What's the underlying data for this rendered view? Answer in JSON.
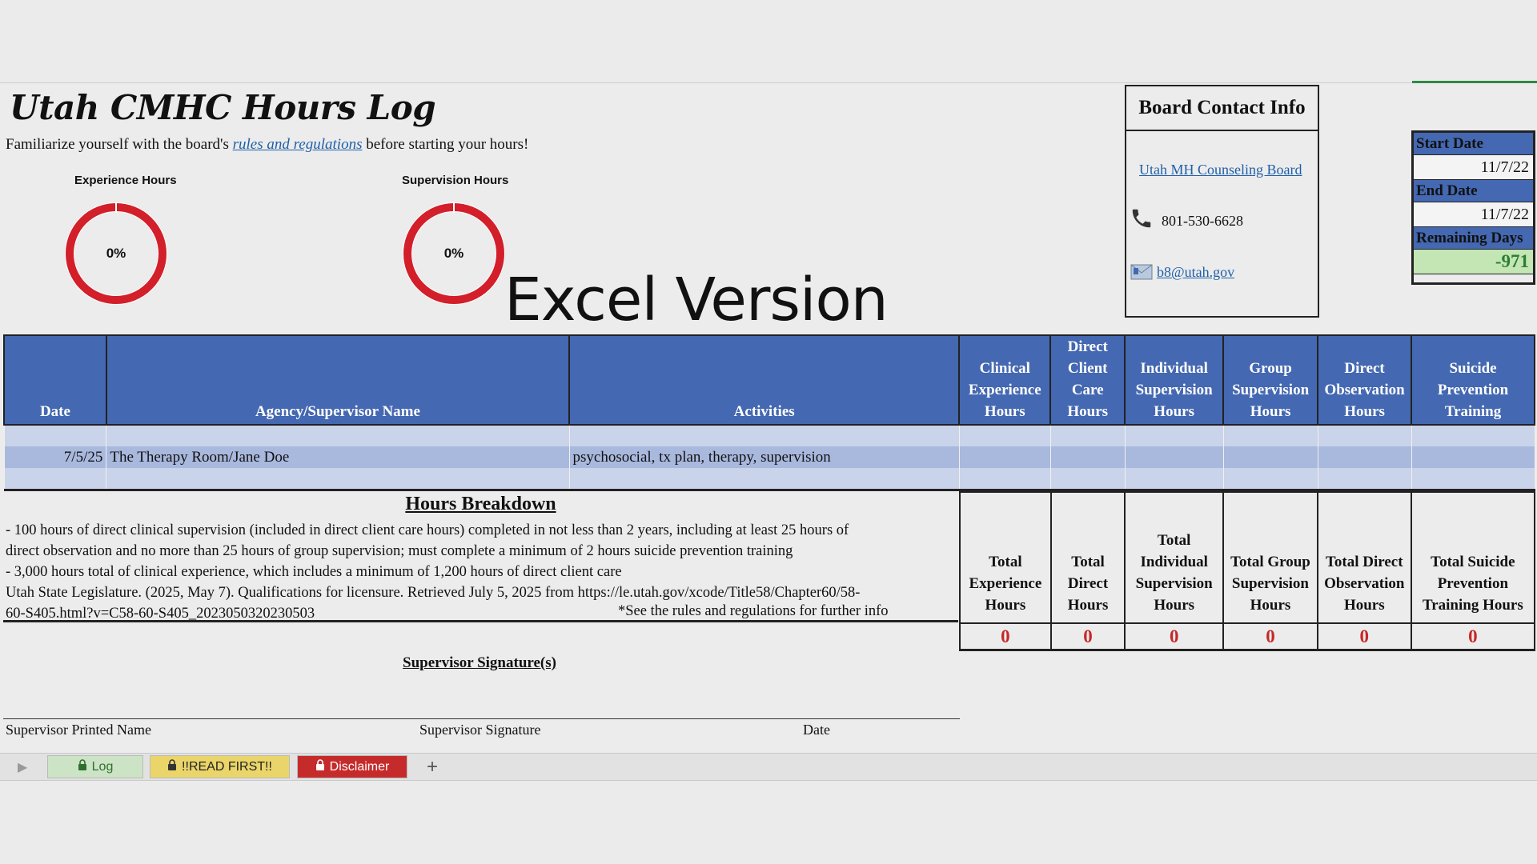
{
  "title": "Utah CMHC Hours Log",
  "intro": {
    "before": "Familiarize yourself with the board's ",
    "link": "rules and regulations",
    "after": " before starting your hours!"
  },
  "donuts": [
    {
      "label": "Experience Hours",
      "percent": "0%",
      "value": 0
    },
    {
      "label": "Supervision Hours",
      "percent": "0%",
      "value": 0
    }
  ],
  "watermark": "Excel Version",
  "contact": {
    "title": "Board Contact Info",
    "board_link": "Utah MH Counseling Board",
    "phone": "801-530-6628",
    "email": "b8@utah.gov",
    "phone_icon": "phone-icon",
    "email_icon": "envelope-icon"
  },
  "dates": {
    "start_label": "Start Date",
    "start_value": "11/7/22",
    "end_label": "End Date",
    "end_value": "11/7/22",
    "remaining_label": "Remaining Days",
    "remaining_value": "-971"
  },
  "log": {
    "headers": [
      "Date",
      "Agency/Supervisor Name",
      "Activities",
      "Clinical Experience Hours",
      "Direct Client Care Hours",
      "Individual Supervision Hours",
      "Group Supervision Hours",
      "Direct Observation Hours",
      "Suicide Prevention Training"
    ],
    "rows": [
      {
        "date": "7/5/25",
        "agency": "The Therapy Room/Jane Doe",
        "activities": "psychosocial, tx plan, therapy, supervision"
      }
    ]
  },
  "breakdown": {
    "title": "Hours Breakdown",
    "lines": [
      "- 100 hours of direct clinical supervision (included in direct client care hours) completed in not less than 2 years, including at least 25 hours of",
      "direct observation and no more than 25 hours of group supervision; must complete a minimum of 2 hours suicide prevention training",
      "- 3,000 hours total of clinical experience, which includes a minimum of 1,200 hours of direct client care",
      "Utah State Legislature. (2025, May 7). Qualifications for licensure. Retrieved July 5, 2025 from https://le.utah.gov/xcode/Title58/Chapter60/58-",
      "60-S405.html?v=C58-60-S405_2023050320230503"
    ],
    "note": "*See the rules and regulations for further info"
  },
  "totals": {
    "headers": [
      "Total Experience Hours",
      "Total Direct Hours",
      "Total Individual Supervision Hours",
      "Total Group Supervision Hours",
      "Total Direct Observation Hours",
      "Total Suicide Prevention Training Hours"
    ],
    "values": [
      "0",
      "0",
      "0",
      "0",
      "0",
      "0"
    ]
  },
  "signature": {
    "title": "Supervisor Signature(s)",
    "printed_name": "Supervisor Printed Name",
    "sig": "Supervisor Signature",
    "date": "Date"
  },
  "tabs": {
    "log": "Log",
    "read_first": "!!READ FIRST!!",
    "disclaimer": "Disclaimer",
    "add": "+"
  },
  "colors": {
    "header_blue": "#4468b1",
    "donut_red": "#d21f2a",
    "total_red": "#c62828",
    "remaining_green": "#2e7d32"
  }
}
